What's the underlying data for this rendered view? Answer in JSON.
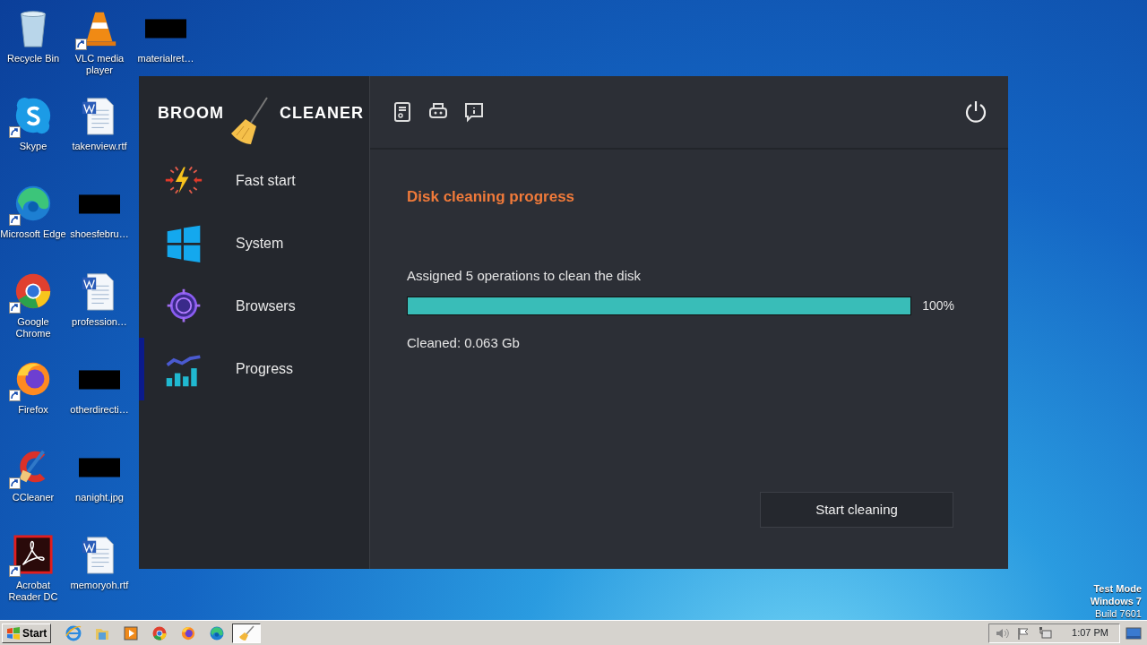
{
  "desktop": {
    "icons": [
      {
        "label": "Recycle Bin",
        "kind": "bin",
        "shortcut": false
      },
      {
        "label": "Skype",
        "kind": "chat",
        "shortcut": true
      },
      {
        "label": "Microsoft Edge",
        "kind": "wave",
        "shortcut": true
      },
      {
        "label": "Google Chrome",
        "kind": "ring",
        "shortcut": true
      },
      {
        "label": "Firefox",
        "kind": "fox",
        "shortcut": true
      },
      {
        "label": "CCleaner",
        "kind": "crescent",
        "shortcut": true
      },
      {
        "label": "Acrobat Reader DC",
        "kind": "pdf",
        "shortcut": true
      },
      {
        "label": "VLC media player",
        "kind": "cone",
        "shortcut": true
      },
      {
        "label": "takenview.rtf",
        "kind": "doc",
        "shortcut": false
      },
      {
        "label": "shoesfebru…",
        "kind": "thumb",
        "shortcut": false
      },
      {
        "label": "profession…",
        "kind": "doc",
        "shortcut": false
      },
      {
        "label": "otherdirecti…",
        "kind": "thumb",
        "shortcut": false
      },
      {
        "label": "nanight.jpg",
        "kind": "thumb",
        "shortcut": false
      },
      {
        "label": "memoryoh.rtf",
        "kind": "doc",
        "shortcut": false
      },
      {
        "label": "materialret…",
        "kind": "thumb",
        "shortcut": false
      }
    ],
    "test_mode": [
      "Test Mode",
      "Windows 7",
      "Build 7601"
    ]
  },
  "app": {
    "logo": {
      "left": "BROOM",
      "right": "CLEANER"
    },
    "nav": [
      {
        "label": "Fast start",
        "kind": "bolt",
        "selected": false
      },
      {
        "label": "System",
        "kind": "windows",
        "selected": false
      },
      {
        "label": "Browsers",
        "kind": "globe",
        "selected": false
      },
      {
        "label": "Progress",
        "kind": "chart",
        "selected": true
      }
    ],
    "content": {
      "title": "Disk cleaning progress",
      "operations": "Assigned 5 operations to clean the disk",
      "progress": {
        "level": 1,
        "reading": "100%"
      },
      "cleaned": "Cleaned: 0.063 Gb",
      "button": "Start cleaning"
    }
  },
  "taskbar": {
    "start": "Start",
    "quick_launch": [
      {
        "kind": "ie"
      },
      {
        "kind": "folder"
      },
      {
        "kind": "media"
      },
      {
        "kind": "ring"
      },
      {
        "kind": "fox"
      },
      {
        "kind": "wave"
      }
    ],
    "window_button": {
      "kind": "broom",
      "active": true
    },
    "clock": "1:07 PM"
  }
}
